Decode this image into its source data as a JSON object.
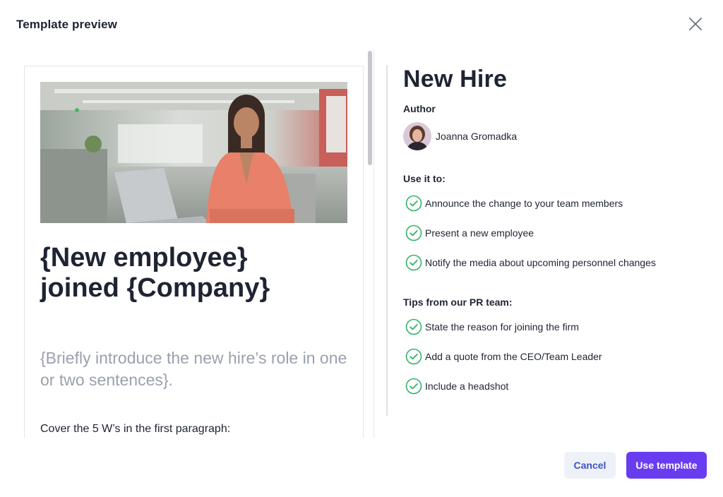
{
  "modal": {
    "title": "Template preview",
    "close_icon": "close-icon"
  },
  "preview": {
    "image": "hero-photo-woman-at-laptop",
    "headline_line1": "{New employee}",
    "headline_line2": "joined {Company}",
    "intro": "{Briefly introduce the new hire’s role in one or two sentences}.",
    "body_first_line": "Cover the 5 W’s in the first paragraph:"
  },
  "details": {
    "template_name": "New Hire",
    "author_heading": "Author",
    "author_name": "Joanna Gromadka",
    "use_it_heading": "Use it to:",
    "use_it_items": [
      "Announce the change to your team members",
      "Present a new employee",
      "Notify the media about upcoming personnel changes"
    ],
    "tips_heading": "Tips from our PR team:",
    "tips_items": [
      "State the reason for joining the firm",
      "Add a quote from the CEO/Team Leader",
      "Include a headshot"
    ],
    "check_icon": "check-circle-icon"
  },
  "footer": {
    "cancel_label": "Cancel",
    "use_template_label": "Use template"
  },
  "colors": {
    "accent": "#6a3cf0",
    "check_green": "#2fb36a",
    "cancel_text": "#3b56c4",
    "cancel_bg": "#eef1f8"
  }
}
